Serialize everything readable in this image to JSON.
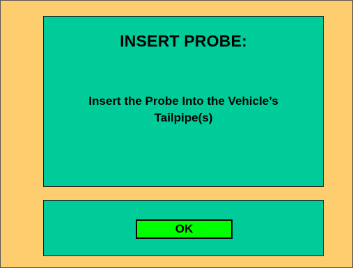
{
  "prompt": {
    "title": "INSERT PROBE:",
    "message_line_1": "Insert the Probe Into the Vehicle’s",
    "message_line_2": "Tailpipe(s)"
  },
  "actions": {
    "ok_label": "OK"
  },
  "colors": {
    "background": "#fecd6e",
    "panel": "#00cc99",
    "button": "#00ff00"
  }
}
